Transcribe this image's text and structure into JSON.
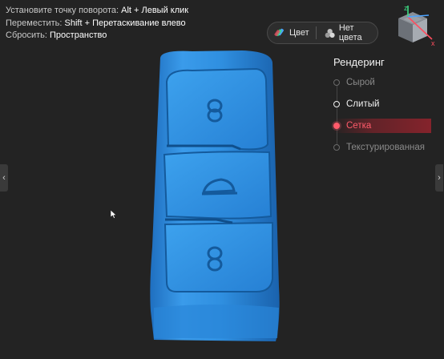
{
  "hints": [
    {
      "label": "Установите точку поворота:",
      "value": "Alt + Левый клик"
    },
    {
      "label": "Переместить:",
      "value": "Shift + Перетаскивание влево"
    },
    {
      "label": "Сбросить:",
      "value": "Пространство"
    }
  ],
  "color_toggle": {
    "color_label": "Цвет",
    "no_color_label": "Нет цвета"
  },
  "view_cube": {
    "axis_z": "z",
    "axis_x": "x"
  },
  "rendering": {
    "title": "Рендеринг",
    "options": [
      {
        "label": "Сырой",
        "state": "inactive"
      },
      {
        "label": "Слитый",
        "state": "on"
      },
      {
        "label": "Сетка",
        "state": "selected"
      },
      {
        "label": "Текстурированная",
        "state": "inactive"
      }
    ]
  },
  "nav": {
    "left_arrow": "‹",
    "right_arrow": "›"
  },
  "colors": {
    "background": "#232323",
    "model_blue": "#2f8fe0",
    "accent_red": "#ff5a6a",
    "axis_z": "#3ddc84",
    "axis_x": "#ff4d5e",
    "axis_y": "#4aa3ff"
  },
  "model": {
    "icon": "car-key-fob-3d-model"
  }
}
